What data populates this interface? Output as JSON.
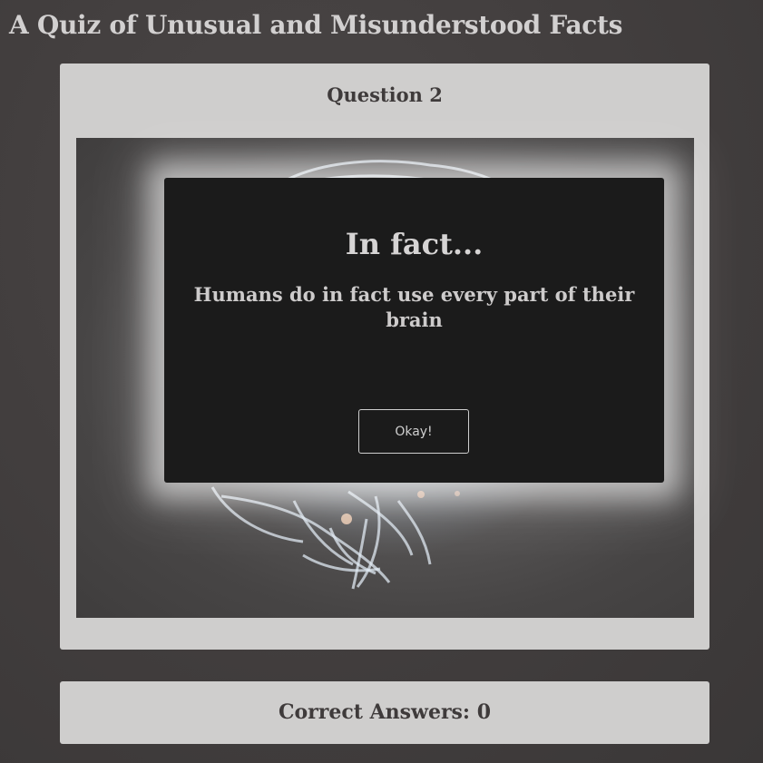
{
  "page": {
    "title": "A Quiz of Unusual and Misunderstood Facts"
  },
  "question": {
    "heading": "Question 2",
    "image_icon": "brain-illustration"
  },
  "modal": {
    "title": "In fact...",
    "message": "Humans do in fact use every part of their brain",
    "button_label": "Okay!"
  },
  "score": {
    "text": "Correct Answers: 0"
  },
  "colors": {
    "background": "#433f3f",
    "card": "#cfcecd",
    "modal": "#1b1b1b",
    "title_text": "#d2d0d0",
    "card_text": "#3f3b3b"
  }
}
